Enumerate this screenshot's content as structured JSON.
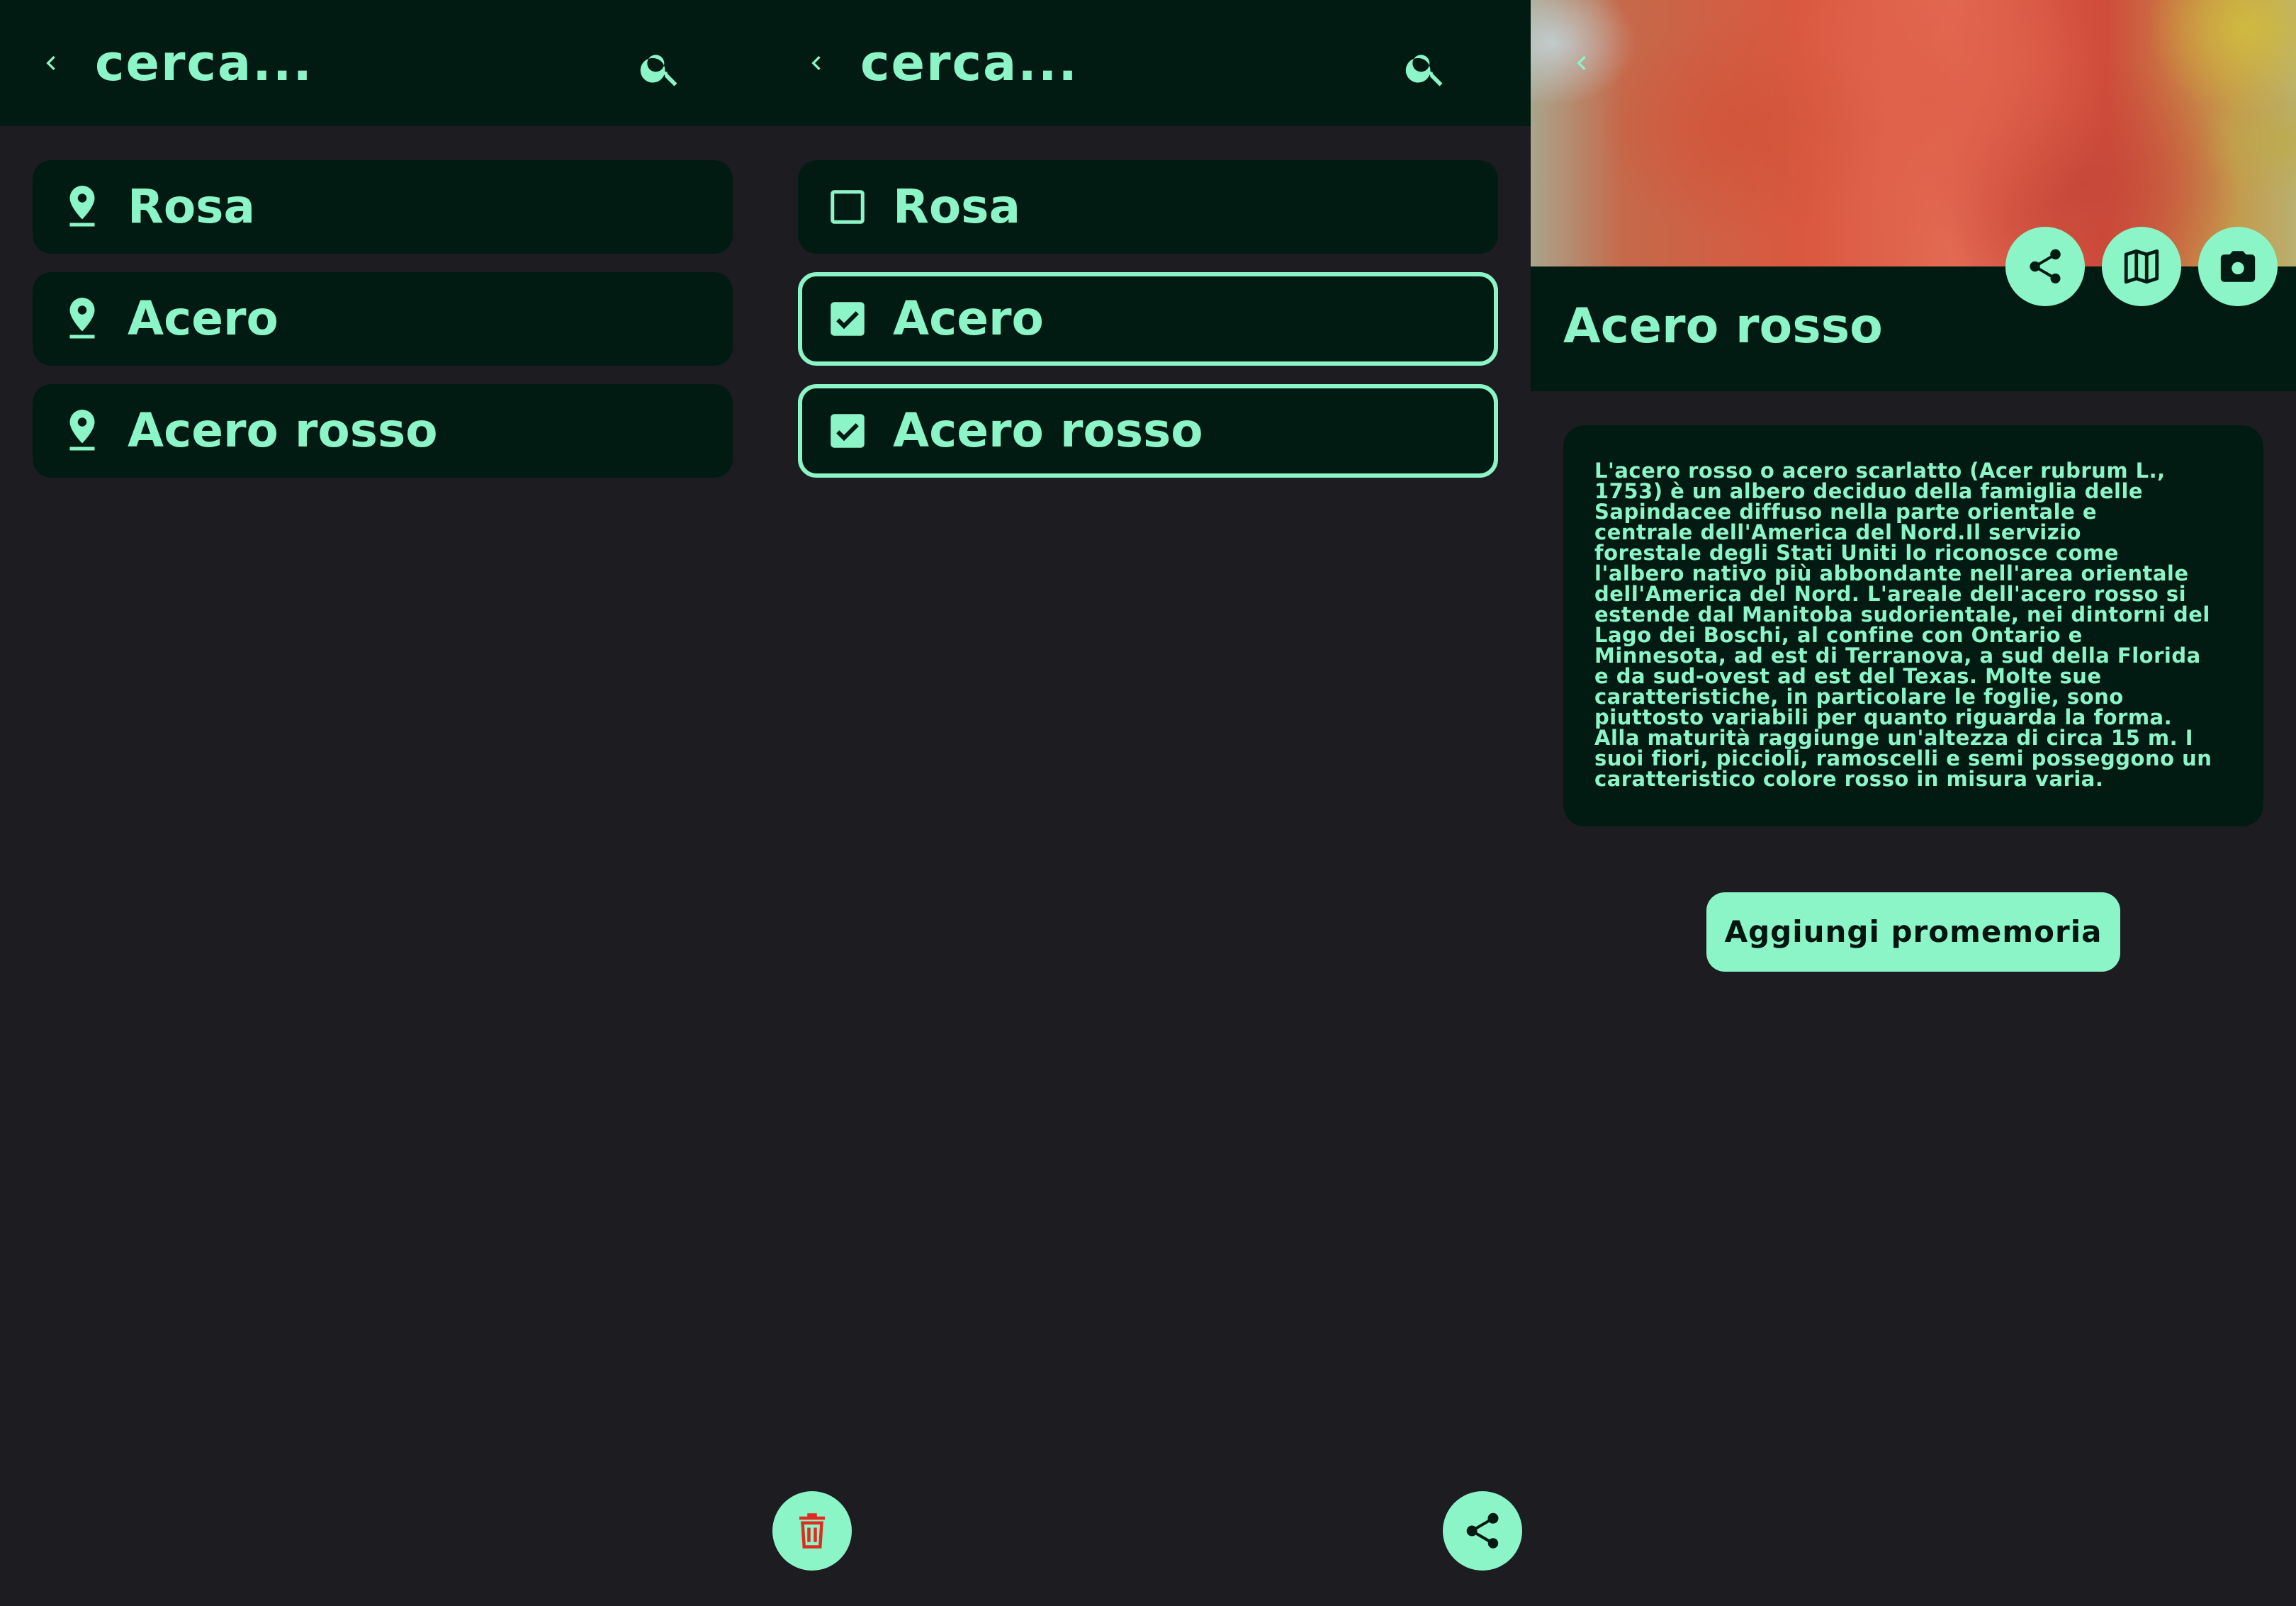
{
  "colors": {
    "background": "#1d1c21",
    "surface": "#021b12",
    "accent": "#8cf5c8",
    "delete_icon": "#e02b22"
  },
  "search_list": {
    "title": "cerca...",
    "items": [
      {
        "label": "Rosa",
        "icon": "location-pin-icon"
      },
      {
        "label": "Acero",
        "icon": "location-pin-icon"
      },
      {
        "label": "Acero rosso",
        "icon": "location-pin-icon"
      }
    ]
  },
  "selection_list": {
    "title": "cerca...",
    "items": [
      {
        "label": "Rosa",
        "checked": false
      },
      {
        "label": "Acero",
        "checked": true
      },
      {
        "label": "Acero rosso",
        "checked": true
      }
    ],
    "fab_delete_icon": "trash-icon",
    "fab_share_icon": "share-icon"
  },
  "detail": {
    "title": "Acero rosso",
    "actions": [
      "share-icon",
      "map-icon",
      "camera-icon"
    ],
    "description_lines": [
      "L'acero rosso o acero scarlatto (Acer rubrum L.,",
      "1753) è un albero deciduo della famiglia delle",
      "Sapindacee diffuso nella parte orientale e",
      "centrale dell'America del Nord.Il servizio",
      "forestale degli Stati Uniti lo riconosce come",
      "l'albero nativo più abbondante nell'area orientale",
      "dell'America del Nord. L'areale dell'acero rosso si",
      "estende dal Manitoba sudorientale, nei dintorni del",
      "Lago dei Boschi, al confine con Ontario e",
      "Minnesota, ad est di Terranova, a sud della Florida",
      "e da sud-ovest ad est del Texas. Molte sue",
      "caratteristiche, in particolare le foglie, sono",
      "piuttosto variabili per quanto riguarda la forma.",
      "Alla maturità raggiunge un'altezza di circa 15 m. I",
      "suoi fiori, piccioli, ramoscelli e semi posseggono un",
      "caratteristico colore rosso in misura varia."
    ],
    "reminder_button": "Aggiungi promemoria"
  }
}
